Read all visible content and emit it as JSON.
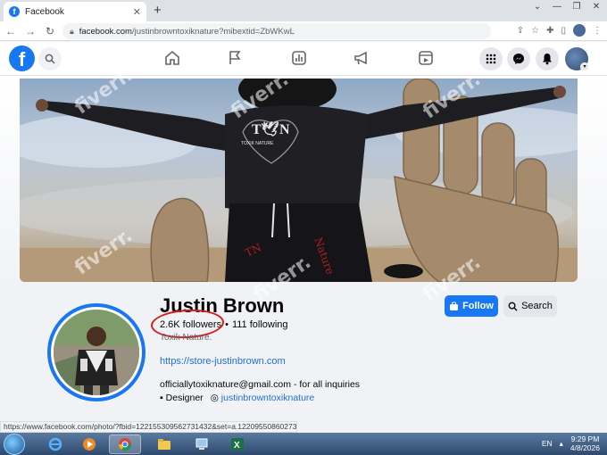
{
  "browser": {
    "tab_title": "Facebook",
    "tab_close": "✕",
    "new_tab": "+",
    "url_host": "facebook.com",
    "url_path": "/justinbrowntoxiknature?mibextid=ZbWKwL",
    "status_url": "https://www.facebook.com/photo/?fbid=122155309562731432&set=a.122095508602731432"
  },
  "profile": {
    "name": "Justin Brown",
    "followers": "2.6K followers",
    "separator": "•",
    "following": "111 following",
    "tagline": "Toxik Nature.",
    "website": "https://store-justinbrown.com",
    "email": "officiallytoxiknature@gmail.com - for all inquiries",
    "category": "Designer",
    "instagram": "justinbrowntoxiknature"
  },
  "actions": {
    "follow_label": "Follow",
    "search_label": "Search"
  },
  "cover": {
    "shirt_text_top": "T🕊N",
    "shirt_text_sub": "TOXIK NATURE"
  },
  "taskbar": {
    "language": "EN",
    "time": "9:29 PM",
    "date": "4/8/2026"
  },
  "watermark": "fiverr.",
  "icons": [
    "facebook-logo",
    "search-icon",
    "home-icon",
    "flag-icon",
    "chart-icon",
    "megaphone-icon",
    "video-icon",
    "menu-grid-icon",
    "messenger-icon",
    "bell-icon"
  ]
}
